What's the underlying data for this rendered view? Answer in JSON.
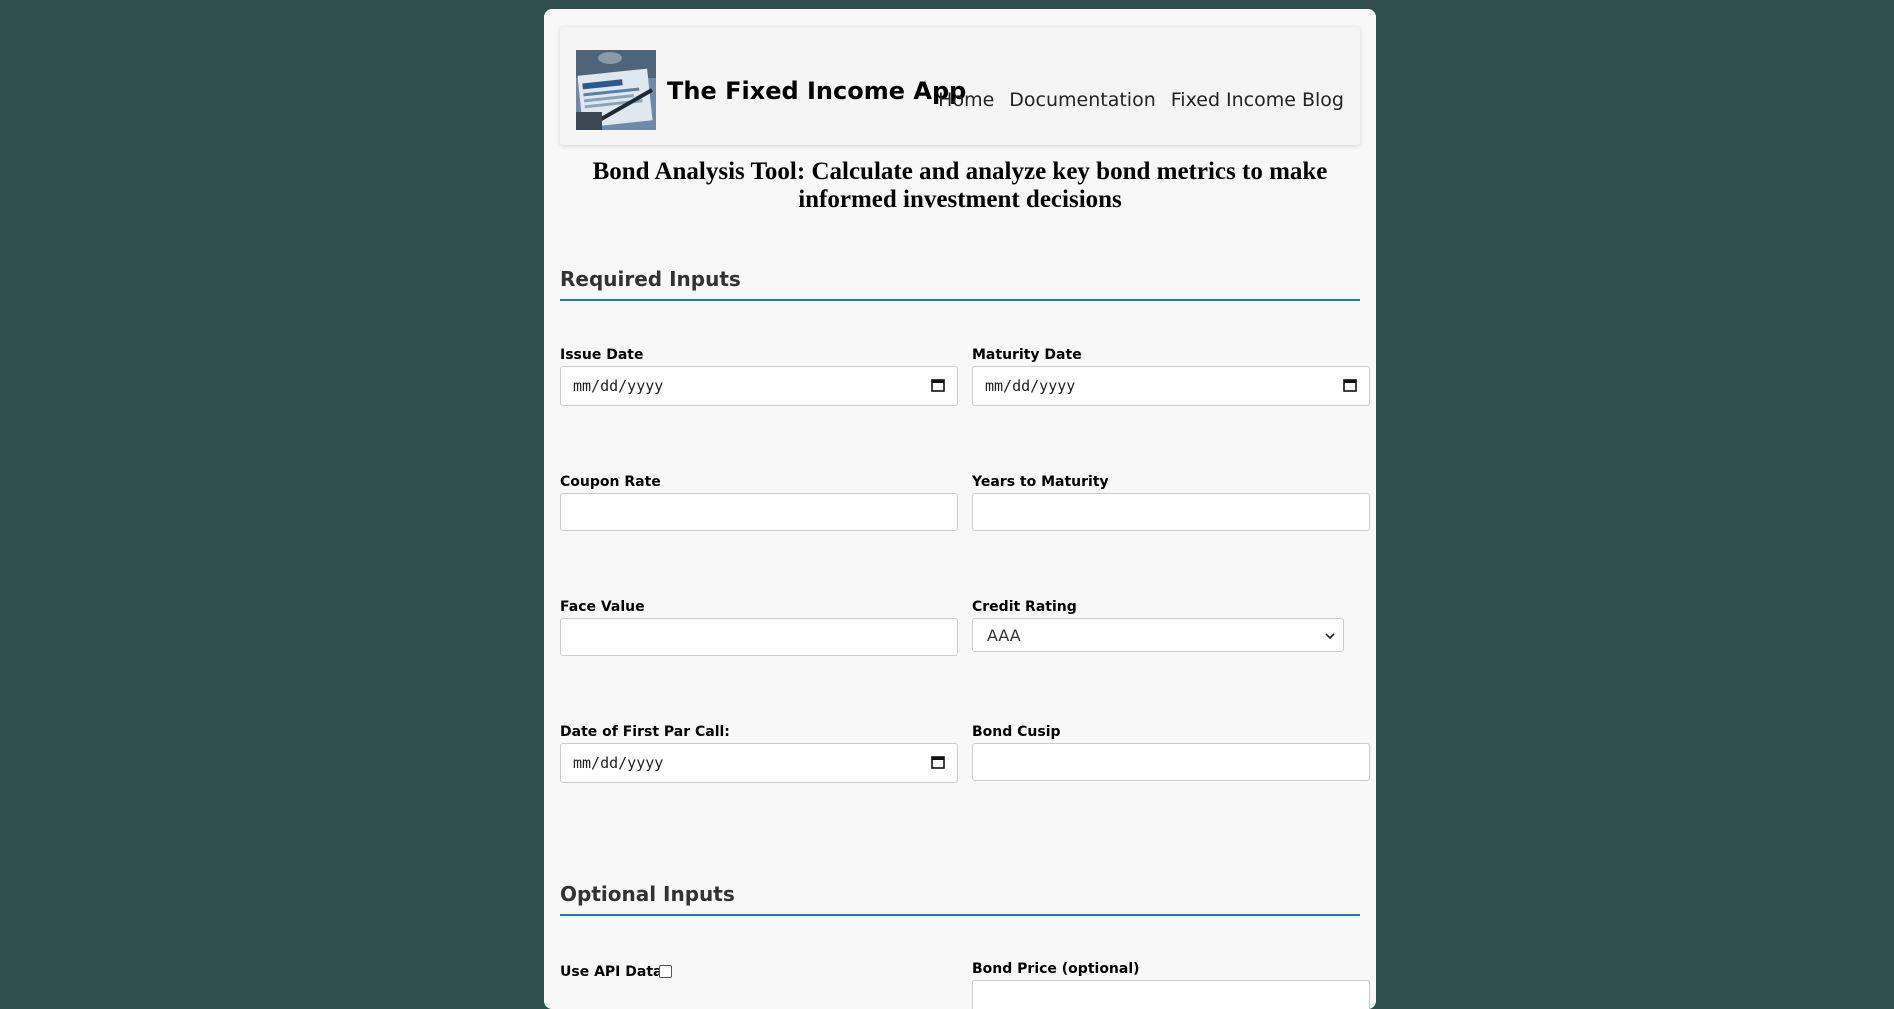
{
  "header": {
    "app_title": "The Fixed Income App",
    "logo_icon": "bond-document-photo",
    "nav": [
      "Home",
      "Documentation",
      "Fixed Income Blog"
    ]
  },
  "page_heading": "Bond Analysis Tool: Calculate and analyze key bond metrics to make informed investment decisions",
  "required_section": {
    "title": "Required Inputs",
    "issue_date": {
      "label": "Issue Date",
      "placeholder": "mm/dd/yyyy"
    },
    "maturity_date": {
      "label": "Maturity Date",
      "placeholder": "mm/dd/yyyy"
    },
    "coupon_rate": {
      "label": "Coupon Rate",
      "value": ""
    },
    "years_to_maturity": {
      "label": "Years to Maturity",
      "value": ""
    },
    "face_value": {
      "label": "Face Value",
      "value": ""
    },
    "credit_rating": {
      "label": "Credit Rating",
      "selected": "AAA"
    },
    "first_par_call": {
      "label": "Date of First Par Call:",
      "placeholder": "mm/dd/yyyy"
    },
    "bond_cusip": {
      "label": "Bond Cusip",
      "value": ""
    }
  },
  "optional_section": {
    "title": "Optional Inputs",
    "use_api_data": {
      "label": "Use API Data",
      "checked": false
    },
    "bond_price": {
      "label": "Bond Price (optional)",
      "value": ""
    }
  },
  "colors": {
    "page_background": "#2f4f4f",
    "panel_background": "#f8f8f8",
    "accent_underline": "#1976d2"
  }
}
